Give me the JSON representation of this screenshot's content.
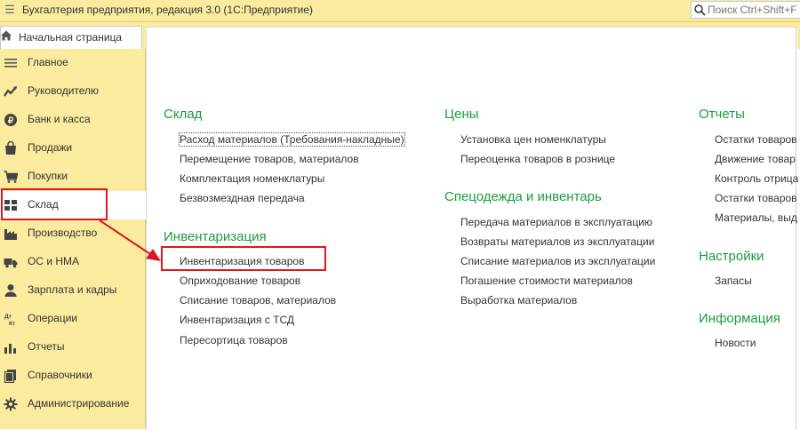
{
  "title_bar": {
    "menu_glyph": "☰",
    "app_title": "Бухгалтерия предприятия, редакция 3.0  (1С:Предприятие)",
    "search_placeholder": "Поиск Ctrl+Shift+F"
  },
  "tabs": {
    "home_label": "Начальная страница"
  },
  "sidebar": {
    "items": [
      {
        "label": "Главное",
        "icon": "menu-lines-icon"
      },
      {
        "label": "Руководителю",
        "icon": "trend-chart-icon"
      },
      {
        "label": "Банк и касса",
        "icon": "coin-icon"
      },
      {
        "label": "Продажи",
        "icon": "shopping-bag-icon"
      },
      {
        "label": "Покупки",
        "icon": "cart-icon"
      },
      {
        "label": "Склад",
        "icon": "warehouse-grid-icon",
        "active": true
      },
      {
        "label": "Производство",
        "icon": "factory-icon"
      },
      {
        "label": "ОС и НМА",
        "icon": "truck-icon"
      },
      {
        "label": "Зарплата и кадры",
        "icon": "person-icon"
      },
      {
        "label": "Операции",
        "icon": "debit-credit-icon"
      },
      {
        "label": "Отчеты",
        "icon": "bar-chart-icon"
      },
      {
        "label": "Справочники",
        "icon": "books-icon"
      },
      {
        "label": "Администрирование",
        "icon": "gear-icon"
      }
    ],
    "dtkt_top": "Дт",
    "dtkt_bottom": "Кт"
  },
  "sections": {
    "sklad": {
      "title": "Склад",
      "links": [
        "Расход материалов (Требования-накладные)",
        "Перемещение товаров, материалов",
        "Комплектация номенклатуры",
        "Безвозмездная передача"
      ]
    },
    "inventarizaciya": {
      "title": "Инвентаризация",
      "links": [
        "Инвентаризация товаров",
        "Оприходование товаров",
        "Списание товаров, материалов",
        "Инвентаризация с ТСД",
        "Пересортица товаров"
      ]
    },
    "ceny": {
      "title": "Цены",
      "links": [
        "Установка цен номенклатуры",
        "Переоценка товаров в рознице"
      ]
    },
    "specodezhda": {
      "title": "Спецодежда и инвентарь",
      "links": [
        "Передача материалов в эксплуатацию",
        "Возвраты материалов из эксплуатации",
        "Списание материалов из эксплуатации",
        "Погашение стоимости материалов",
        "Выработка материалов"
      ]
    },
    "otchety": {
      "title": "Отчеты",
      "links": [
        "Остатки товаров",
        "Движение товар",
        "Контроль отрица",
        "Остатки товаров",
        "Материалы, выд"
      ]
    },
    "nastroyki": {
      "title": "Настройки",
      "links": [
        "Запасы"
      ]
    },
    "informaciya": {
      "title": "Информация",
      "links": [
        "Новости"
      ]
    }
  },
  "annotation": {
    "color": "#e0161d"
  },
  "colors": {
    "panel": "#fbeb9f",
    "section_title": "#1c9b3f"
  }
}
